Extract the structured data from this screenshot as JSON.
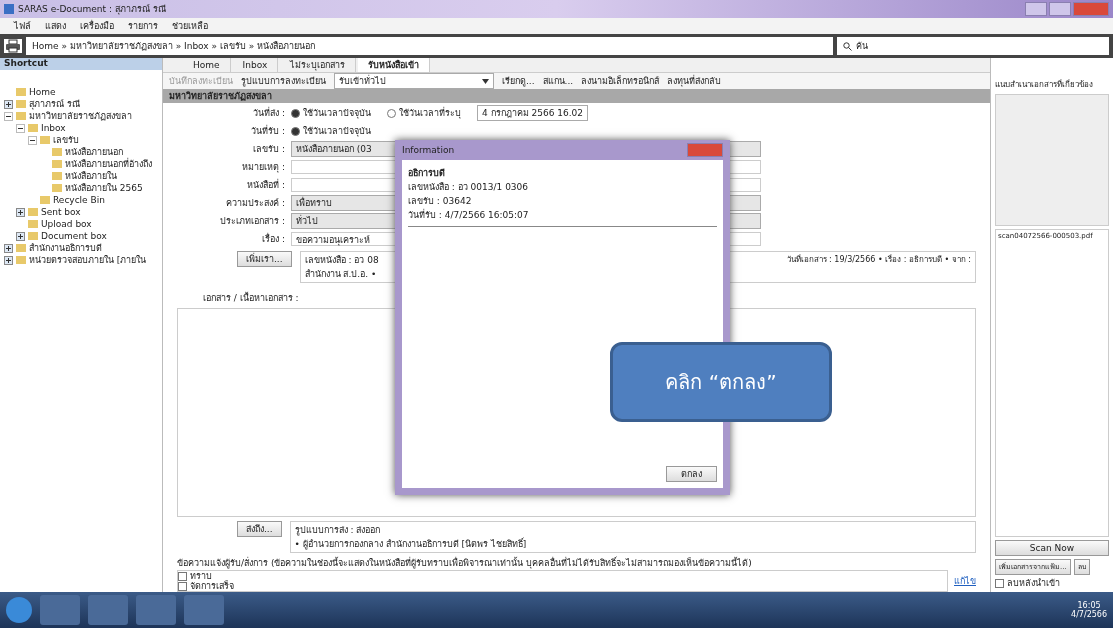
{
  "window": {
    "title": "SARAS e-Document : สุภาภรณ์ รณี"
  },
  "menu": [
    "ไฟล์",
    "แสดง",
    "เครื่องมือ",
    "รายการ",
    "ช่วยเหลือ"
  ],
  "address": {
    "path": "Home » มหาวิทยาลัยราชภัฏสงขลา » Inbox » เลขรับ » หนังสือภายนอก",
    "search": "ค้น"
  },
  "sidebar": {
    "title": "Shortcut",
    "tree": [
      {
        "label": "Home"
      },
      {
        "label": "สุภาภรณ์ รณี",
        "expanded": false
      },
      {
        "label": "มหาวิทยาลัยราชภัฏสงขลา",
        "expanded": true,
        "children": [
          {
            "label": "Inbox",
            "expanded": true,
            "children": [
              {
                "label": "เลขรับ",
                "expanded": true,
                "children": [
                  {
                    "label": "หนังสือภายนอก"
                  },
                  {
                    "label": "หนังสือภายนอกที่อ้างถึง"
                  },
                  {
                    "label": "หนังสือภายใน"
                  },
                  {
                    "label": "หนังสือภายใน 2565"
                  }
                ]
              },
              {
                "label": "Recycle Bin"
              }
            ]
          },
          {
            "label": "Sent box",
            "expanded": false
          },
          {
            "label": "Upload box"
          },
          {
            "label": "Document box",
            "expanded": false
          }
        ]
      },
      {
        "label": "สำนักงานอธิการบดี",
        "expanded": false
      },
      {
        "label": "หน่วยตรวจสอบภายใน [ภายใน",
        "expanded": false
      }
    ]
  },
  "tabs": [
    {
      "label": "Home",
      "selected": false
    },
    {
      "label": "Inbox",
      "selected": false
    },
    {
      "label": "ไม่ระบุเอกสาร",
      "selected": false
    },
    {
      "label": "รับหนังสือเข้า",
      "selected": true
    }
  ],
  "toolbar": {
    "left": "บันทึกลงทะเบียน",
    "template": "รูปแบบการลงทะเบียน",
    "template_value": "รับเข้าทั่วไป",
    "actions": [
      "เรียกดู...",
      "สแกน...",
      "ลงนามอิเล็กทรอนิกส์",
      "ลงทุนที่ส่งกลับ"
    ]
  },
  "section_title": "มหาวิทยาลัยราชภัฏสงขลา",
  "form": [
    {
      "kind": "radio",
      "label": "วันที่ส่ง :",
      "options": [
        {
          "label": "ใช้วันเวลาปัจจุบัน",
          "selected": true
        },
        {
          "label": "ใช้วันเวลาที่ระบุ",
          "selected": false
        }
      ],
      "date": "4 กรกฎาคม 2566 16.02"
    },
    {
      "kind": "radio",
      "label": "วันที่รับ :",
      "options": [
        {
          "label": "ใช้วันเวลาปัจจุบัน",
          "selected": true
        }
      ]
    },
    {
      "kind": "select",
      "label": "เลขรับ :",
      "value": "หนังสือภายนอก (03"
    },
    {
      "kind": "input",
      "label": "หมายเหตุ :"
    },
    {
      "kind": "input",
      "label": "หนังสือที่ :"
    },
    {
      "kind": "select",
      "label": "ความประสงค์ :",
      "value": "เพื่อทราบ"
    },
    {
      "kind": "select",
      "label": "ประเภทเอกสาร :",
      "value": "ทั่วไป"
    },
    {
      "kind": "text",
      "label": "เรื่อง :",
      "value": "ขอความอนุเคราะห์"
    }
  ],
  "from_row": {
    "button": "เพิ่มเรา...",
    "line_1": "เลขหนังสือ : อว 08",
    "line_2": "สำนักงาน ส.ป.อ. •",
    "right": "วันที่เอกสาร : 19/3/2566 • เรื่อง : อธิการบดี • จาก :"
  },
  "content_label": "เอกสาร / เนื้อหาเอกสาร :",
  "send_row": {
    "button": "ส่งถึง...",
    "line_1": "รูปแบบการส่ง : ส่งออก",
    "line_2": "• ผู้อำนวยการกองกลาง สำนักงานอธิการบดี [นิตพร ไชยสิทธิ์]"
  },
  "note": "ข้อความแจ้งผู้รับ/สั่งการ (ข้อความในช่องนี้จะแสดงในหนังสือที่ผู้รับทราบเพื่อพิจารณาเท่านั้น บุคคลอื่นที่ไม่ได้รับสิทธิ์จะไม่สามารถมองเห็นข้อความนี้ได้)",
  "actions_list": [
    {
      "label": "ทราบ",
      "checked": false
    },
    {
      "label": "จัดการเสร็จ",
      "checked": false
    }
  ],
  "edit_link": "แก้ไข",
  "right_pane": {
    "title": "แนบสำเนาเอกสารที่เกี่ยวข้อง",
    "file": "scan04072566-000503.pdf",
    "scan": "Scan Now",
    "add": "เพิ่มเอกสารจากแฟ้ม...",
    "delete": "ลบ",
    "delete_after": {
      "label": "ลบหลังนำเข้า",
      "checked": false
    }
  },
  "dialog": {
    "title": "Information",
    "lines": [
      "อธิการบดี",
      "เลขหนังสือ : อว 0013/1 0306",
      "เลขรับ : 03642",
      "วันที่รับ : 4/7/2566 16:05:07"
    ],
    "button": "ตกลง"
  },
  "callout": "คลิก “ตกลง”",
  "taskbar": {
    "time": "16:05",
    "date": "4/7/2566"
  }
}
